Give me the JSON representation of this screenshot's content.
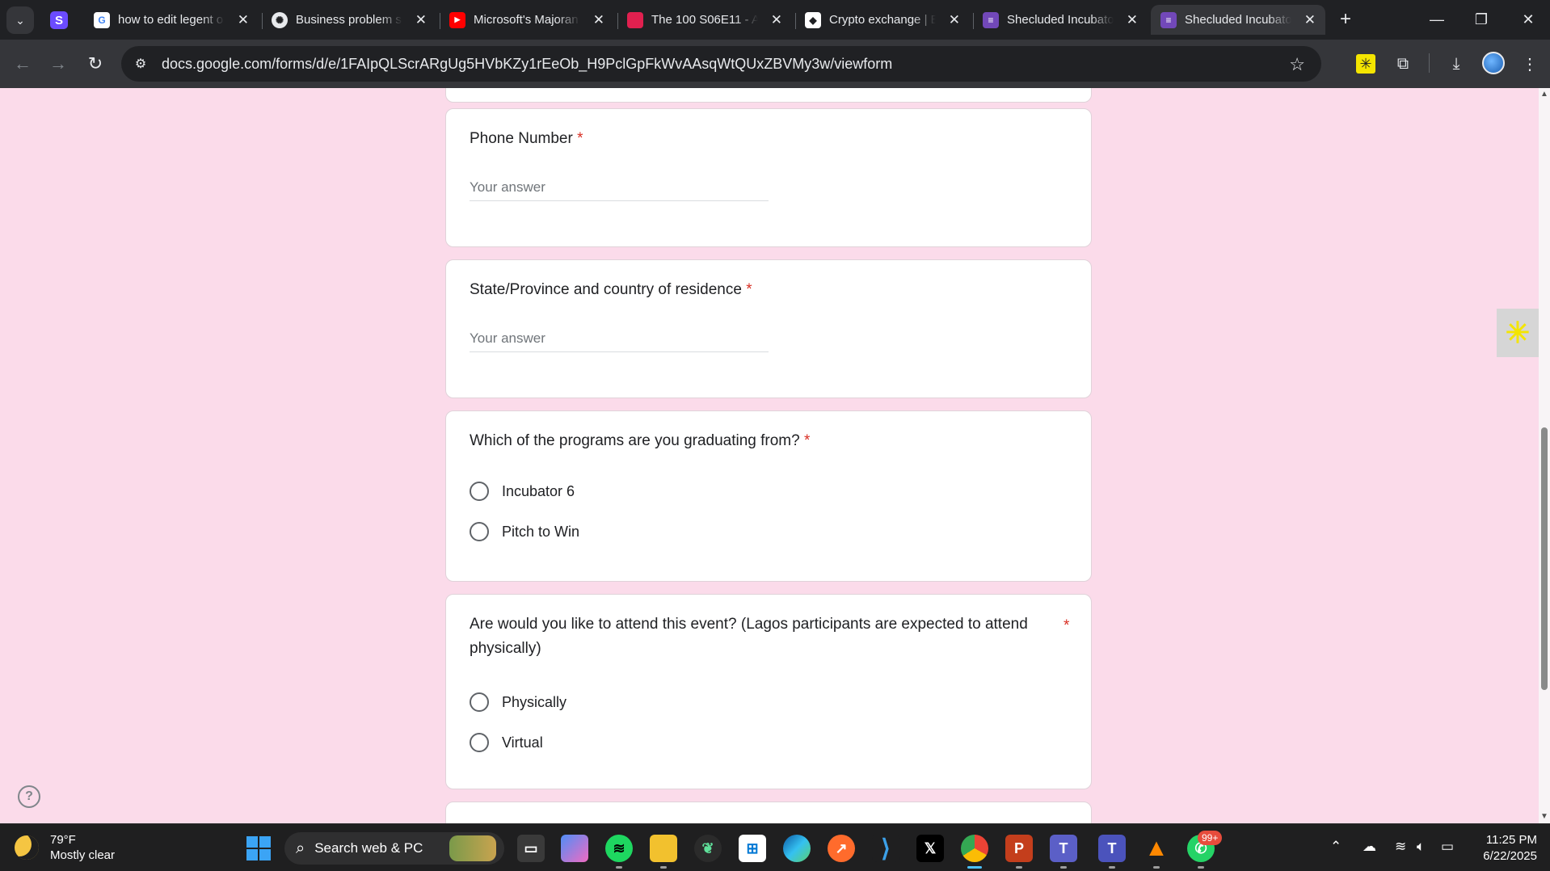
{
  "browser": {
    "tabs": [
      {
        "title": "how to edit legent o",
        "favicon": "google-icon",
        "active": false
      },
      {
        "title": "Business problem so",
        "favicon": "openai-icon",
        "active": false
      },
      {
        "title": "Microsoft's Majoran",
        "favicon": "youtube-icon",
        "active": false
      },
      {
        "title": "The 100 S06E11 - Al",
        "favicon": "video-site-icon",
        "active": false
      },
      {
        "title": "Crypto exchange | B",
        "favicon": "exchange-icon",
        "active": false
      },
      {
        "title": "Shecluded Incubato",
        "favicon": "google-forms-icon",
        "active": false
      },
      {
        "title": "Shecluded Incubato",
        "favicon": "google-forms-icon",
        "active": true
      }
    ],
    "url": "docs.google.com/forms/d/e/1FAIpQLScrARgUg5HVbKZy1rEeOb_H9PclGpFkWvAAsqWtQUxZBVMy3w/viewform",
    "colors": {
      "frame": "#202124",
      "toolbar": "#35363a",
      "page_bg": "#fbdbea",
      "required": "#d93025"
    }
  },
  "form": {
    "q_phone": {
      "label": "Phone Number",
      "required_mark": "*",
      "placeholder": "Your answer"
    },
    "q_state": {
      "label": "State/Province and country of residence",
      "required_mark": "*",
      "placeholder": "Your answer"
    },
    "q_program": {
      "label": "Which of the programs are you graduating from?",
      "required_mark": "*",
      "options": [
        "Incubator 6",
        "Pitch to Win"
      ]
    },
    "q_attend": {
      "label": "Are would you like to attend this event? (Lagos participants are expected to attend physically)",
      "required_mark": "*",
      "options": [
        "Physically",
        "Virtual"
      ]
    }
  },
  "taskbar": {
    "weather": {
      "temp": "79°F",
      "condition": "Mostly clear"
    },
    "search_placeholder": "Search web & PC",
    "whatsapp_badge": "99+",
    "time": "11:25 PM",
    "date": "6/22/2025"
  }
}
